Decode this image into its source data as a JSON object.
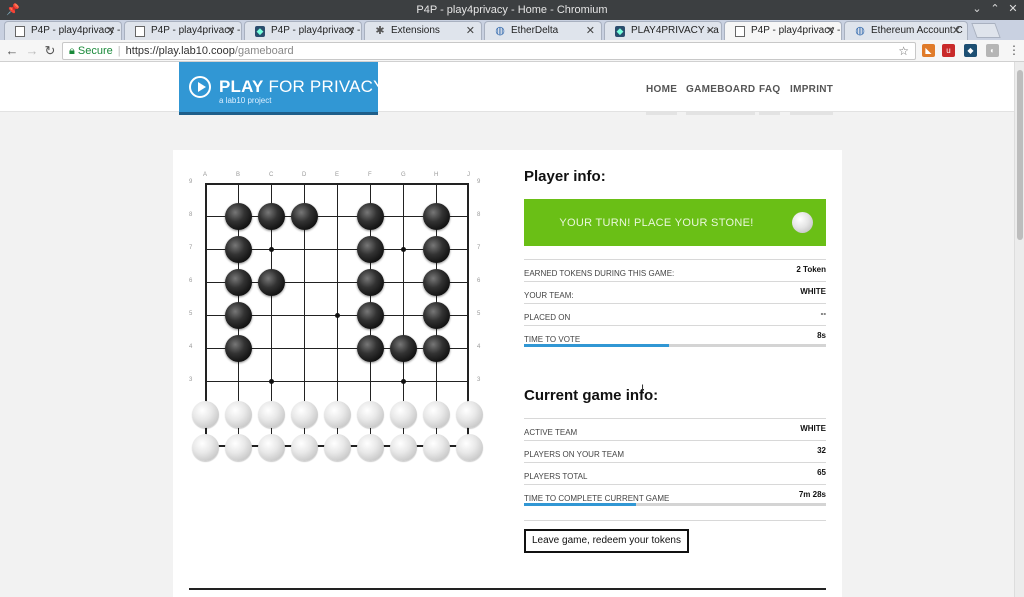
{
  "window": {
    "title": "P4P - play4privacy - Home - Chromium",
    "controls": [
      "⌄",
      "⌃",
      "✕"
    ]
  },
  "tabs": [
    {
      "label": "P4P - play4privacy - ",
      "icon": "document-icon",
      "active": false
    },
    {
      "label": "P4P - play4privacy - ",
      "icon": "document-icon",
      "active": false
    },
    {
      "label": "P4P - play4privacy - ",
      "icon": "app-icon",
      "active": false
    },
    {
      "label": "Extensions",
      "icon": "puzzle-icon",
      "active": false
    },
    {
      "label": "EtherDelta",
      "icon": "globe-icon",
      "active": false
    },
    {
      "label": "PLAY4PRIVACY - a la",
      "icon": "app-icon",
      "active": false
    },
    {
      "label": "P4P - play4privacy - ",
      "icon": "document-icon",
      "active": true
    },
    {
      "label": "Ethereum Account C",
      "icon": "globe-icon",
      "active": false
    }
  ],
  "addressbar": {
    "secure_label": "Secure",
    "url_host": "https://play.lab10.coop",
    "url_path": "/gameboard"
  },
  "site": {
    "logo_play": "PLAY",
    "logo_rest": " FOR PRIVACY",
    "logo_sub": "a lab10 project",
    "nav": [
      "HOME",
      "GAMEBOARD",
      "FAQ",
      "IMPRINT"
    ]
  },
  "board": {
    "columns": [
      "A",
      "B",
      "C",
      "D",
      "E",
      "F",
      "G",
      "H",
      "J"
    ],
    "rows": [
      "9",
      "8",
      "7",
      "6",
      "5",
      "4",
      "3"
    ],
    "black_stones": [
      [
        "B",
        8
      ],
      [
        "C",
        8
      ],
      [
        "D",
        8
      ],
      [
        "F",
        8
      ],
      [
        "H",
        8
      ],
      [
        "B",
        7
      ],
      [
        "F",
        7
      ],
      [
        "H",
        7
      ],
      [
        "B",
        6
      ],
      [
        "C",
        6
      ],
      [
        "F",
        6
      ],
      [
        "H",
        6
      ],
      [
        "B",
        5
      ],
      [
        "F",
        5
      ],
      [
        "H",
        5
      ],
      [
        "B",
        4
      ],
      [
        "F",
        4
      ],
      [
        "G",
        4
      ],
      [
        "H",
        4
      ]
    ],
    "white_stones_rows": [
      2,
      1
    ],
    "hoshi": [
      [
        "C",
        7
      ],
      [
        "G",
        7
      ],
      [
        "E",
        5
      ],
      [
        "C",
        3
      ],
      [
        "G",
        3
      ]
    ]
  },
  "player_info": {
    "heading": "Player info:",
    "turn_message": "YOUR TURN! PLACE YOUR STONE!",
    "rows": [
      {
        "key": "EARNED TOKENS DURING THIS GAME:",
        "value": "2 Token"
      },
      {
        "key": "YOUR TEAM:",
        "value": "WHITE"
      },
      {
        "key": "PLACED ON",
        "value": "--"
      },
      {
        "key": "TIME TO VOTE",
        "value": "8s"
      }
    ],
    "vote_progress": 0.48
  },
  "game_info": {
    "heading": "Current game info:",
    "rows": [
      {
        "key": "ACTIVE TEAM",
        "value": "WHITE"
      },
      {
        "key": "PLAYERS ON YOUR TEAM",
        "value": "32"
      },
      {
        "key": "PLAYERS TOTAL",
        "value": "65"
      },
      {
        "key": "TIME TO COMPLETE CURRENT GAME",
        "value": "7m 28s"
      }
    ],
    "game_progress": 0.37
  },
  "leave_button": "Leave game, redeem your tokens"
}
